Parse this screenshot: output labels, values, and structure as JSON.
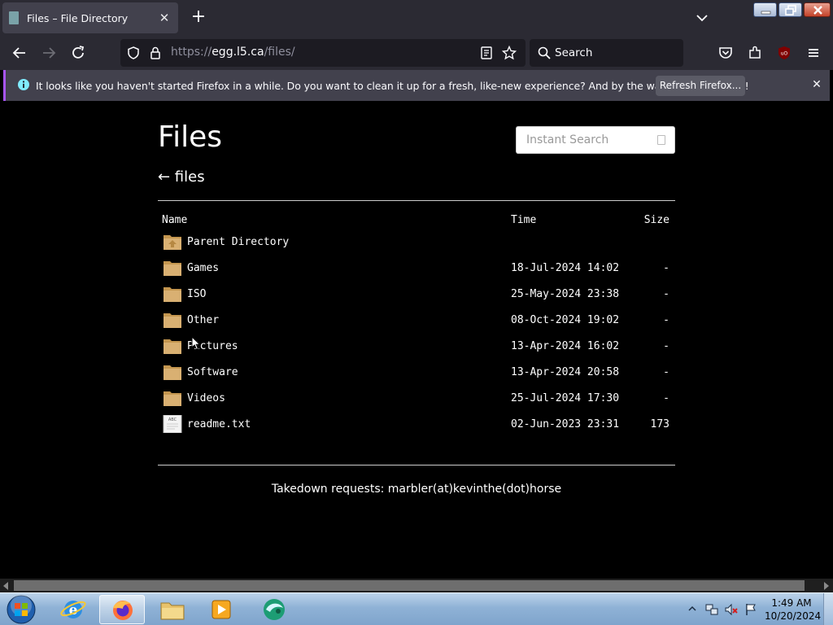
{
  "browser": {
    "tab_title": "Files – File Directory",
    "url_prefix": "https://",
    "url_host": "egg.l5.ca",
    "url_path": "/files/",
    "search_placeholder": "Search"
  },
  "notification": {
    "message": "It looks like you haven't started Firefox in a while. Do you want to clean it up for a fresh, like-new experience? And by the way, welcome back!",
    "button_label": "Refresh Firefox..."
  },
  "page": {
    "title": "Files",
    "search_placeholder": "Instant Search",
    "back_link": "← files",
    "columns": {
      "name": "Name",
      "time": "Time",
      "size": "Size"
    },
    "entries": [
      {
        "name": "Parent Directory",
        "time": "",
        "size": "",
        "type": "parent"
      },
      {
        "name": "Games",
        "time": "18-Jul-2024 14:02",
        "size": "-",
        "type": "folder"
      },
      {
        "name": "ISO",
        "time": "25-May-2024 23:38",
        "size": "-",
        "type": "folder"
      },
      {
        "name": "Other",
        "time": "08-Oct-2024 19:02",
        "size": "-",
        "type": "folder"
      },
      {
        "name": "Pictures",
        "time": "13-Apr-2024 16:02",
        "size": "-",
        "type": "folder"
      },
      {
        "name": "Software",
        "time": "13-Apr-2024 20:58",
        "size": "-",
        "type": "folder"
      },
      {
        "name": "Videos",
        "time": "25-Jul-2024 17:30",
        "size": "-",
        "type": "folder"
      },
      {
        "name": "readme.txt",
        "time": "02-Jun-2023 23:31",
        "size": "173",
        "type": "text"
      }
    ],
    "footer": "Takedown requests: marbler(at)kevinthe(dot)horse"
  },
  "taskbar": {
    "time": "1:49 AM",
    "date": "10/20/2024",
    "pinned": [
      "internet-explorer",
      "firefox",
      "file-explorer",
      "media-player",
      "unknown-app"
    ]
  },
  "colors": {
    "page_background": "#000000",
    "browser_chrome": "#2b2a33",
    "notification_accent": "#a855f7",
    "folder": "#d9b072"
  }
}
